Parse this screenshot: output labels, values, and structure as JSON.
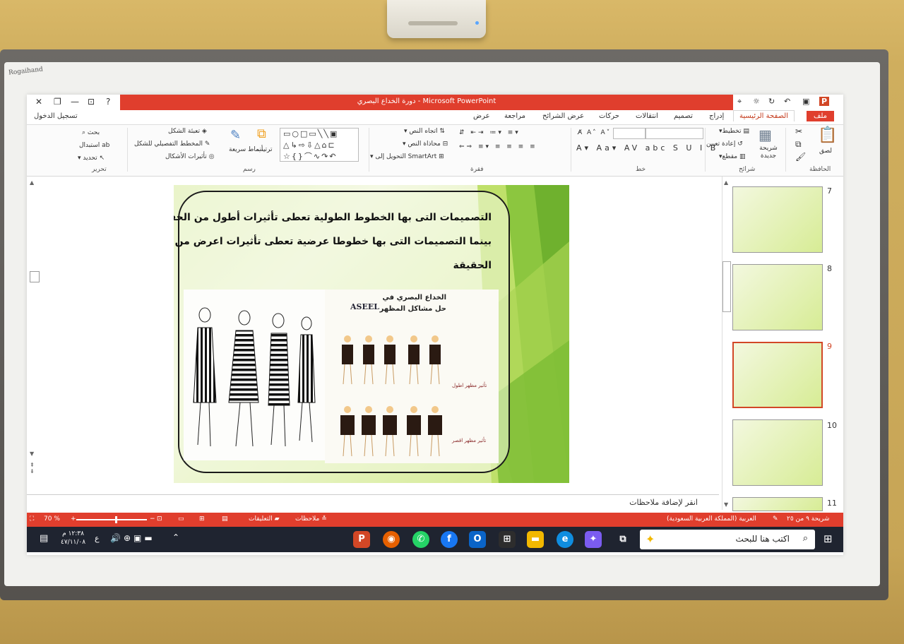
{
  "window": {
    "title": "دورة الخداع البصري - Microsoft PowerPoint",
    "sign_in": "تسجيل الدخول"
  },
  "tabs": {
    "file": "ملف",
    "home": "الصفحة الرئيسية",
    "insert": "إدراج",
    "design": "تصميم",
    "transitions": "انتقالات",
    "animations": "حركات",
    "slideshow": "عرض الشرائح",
    "review": "مراجعة",
    "view": "عرض"
  },
  "ribbon": {
    "clipboard": {
      "paste": "لصق",
      "label": "الحافظة"
    },
    "slides": {
      "new_slide": "شريحة جديدة",
      "layout": "تخطيط",
      "reset": "إعادة تعيين",
      "section": "مقطع",
      "label": "شرائح"
    },
    "font": {
      "label": "خط"
    },
    "paragraph": {
      "text_direction": "اتجاه النص",
      "align_text": "محاذاة النص",
      "smartart": "التحويل إلى SmartArt",
      "label": "فقرة"
    },
    "drawing": {
      "arrange": "ترتيب",
      "quick_styles": "أنماط سريعة",
      "shape_fill": "تعبئة الشكل",
      "shape_outline": "المخطط التفصيلي للشكل",
      "shape_effects": "تأثيرات الأشكال",
      "label": "رسم"
    },
    "editing": {
      "find": "بحث",
      "replace": "استبدال",
      "select": "تحديد",
      "label": "تحرير"
    }
  },
  "slide": {
    "lines": [
      "التصميمات  التى بها الخطوط الطولية تعطى تأثيرات أطول من الحقيقة",
      "بينما التصميمات التى بها خطوطا عرضية تعطى تأثيرات اعرض من",
      "الحقيقة"
    ],
    "image_title_1": "الخداع البصري في",
    "image_title_2": "حل مشاكل المظهر",
    "brand": "ASEEL",
    "caption_1": "تأثير مظهر اطول",
    "caption_2": "تأثير مظهر اقصر"
  },
  "notes_placeholder": "انقر لإضافة ملاحظات",
  "thumbnails": [
    {
      "num": "7"
    },
    {
      "num": "8"
    },
    {
      "num": "9",
      "selected": true
    },
    {
      "num": "10"
    },
    {
      "num": "11"
    }
  ],
  "status": {
    "slide_counter": "شريحة ٩ من ٢٥",
    "language": "العربية (المملكة العربية السعودية)",
    "notes": "ملاحظات",
    "comments": "التعليقات",
    "zoom": "70 %",
    "zoom_level": 0.55
  },
  "taskbar": {
    "search_placeholder": "اكتب هنا للبحث",
    "time": "١٢:٣٨ م",
    "date": "٤٧/١١/٠٨",
    "lang_indicator": "ع"
  },
  "colors": {
    "accent": "#e03e2d",
    "slide_green": "#8cc63f"
  }
}
